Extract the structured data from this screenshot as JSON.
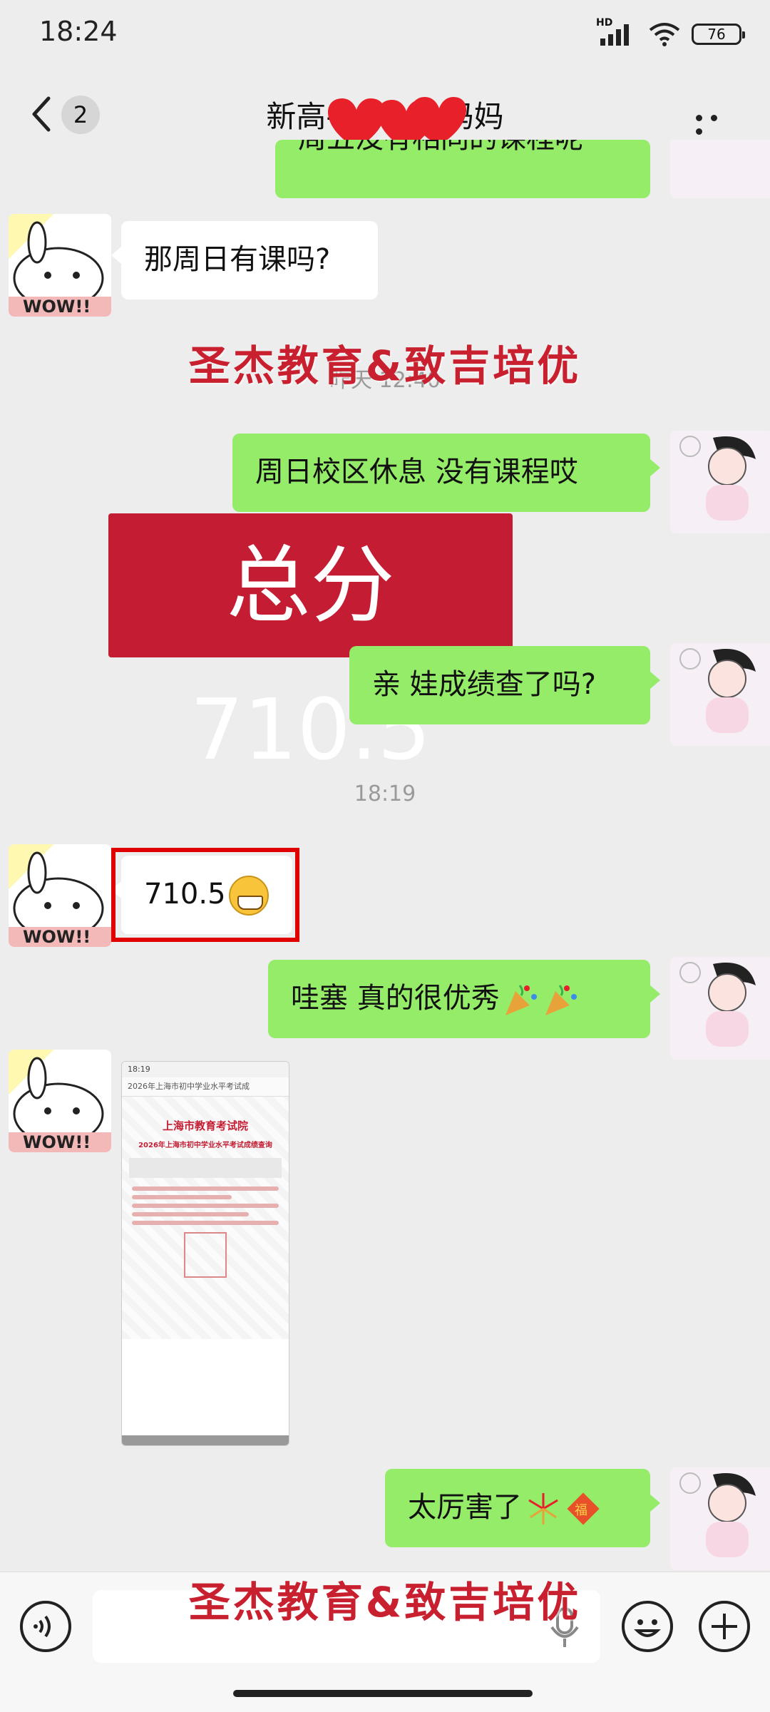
{
  "status": {
    "time": "18:24",
    "hd": "HD",
    "battery": "76"
  },
  "nav": {
    "unread_count": "2",
    "title": "新高-",
    "title_suffix": "妈妈"
  },
  "messages": {
    "m0_partial": "周五没有相同的课程呢",
    "m1": "那周日有课吗?",
    "ts1_hidden": "昨天 12:40",
    "m2": "周日校区休息 没有课程哎",
    "m3": "亲 娃成绩查了吗?",
    "ts2": "18:19",
    "m4": "710.5",
    "m5": "哇塞  真的很优秀",
    "m6": "太厉害了"
  },
  "overlays": {
    "watermark": "圣杰教育&致吉培优",
    "score_banner": "总分710.5"
  },
  "thumbnail": {
    "status_time": "18:19",
    "page_title": "2026年上海市初中学业水平考试成",
    "heading": "上海市教育考试院",
    "subheading": "2026年上海市初中学业水平考试成绩查询"
  },
  "icons": {
    "back": "back-chevron-icon",
    "more": "more-icon",
    "voice": "voice-icon",
    "mic": "mic-icon",
    "emoji": "emoji-icon",
    "plus": "plus-icon"
  },
  "colors": {
    "bubble_green": "#95ec69",
    "watermark_red": "#c8202f",
    "banner_red": "#c41d33",
    "highlight_red": "#e10000"
  }
}
